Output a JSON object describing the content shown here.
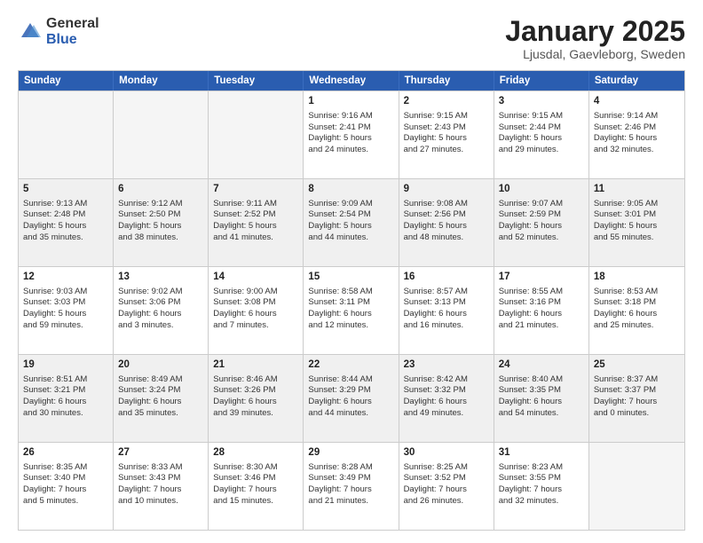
{
  "logo": {
    "general": "General",
    "blue": "Blue"
  },
  "header": {
    "title": "January 2025",
    "subtitle": "Ljusdal, Gaevleborg, Sweden"
  },
  "weekdays": [
    "Sunday",
    "Monday",
    "Tuesday",
    "Wednesday",
    "Thursday",
    "Friday",
    "Saturday"
  ],
  "weeks": [
    [
      {
        "day": "",
        "info": ""
      },
      {
        "day": "",
        "info": ""
      },
      {
        "day": "",
        "info": ""
      },
      {
        "day": "1",
        "info": "Sunrise: 9:16 AM\nSunset: 2:41 PM\nDaylight: 5 hours\nand 24 minutes."
      },
      {
        "day": "2",
        "info": "Sunrise: 9:15 AM\nSunset: 2:43 PM\nDaylight: 5 hours\nand 27 minutes."
      },
      {
        "day": "3",
        "info": "Sunrise: 9:15 AM\nSunset: 2:44 PM\nDaylight: 5 hours\nand 29 minutes."
      },
      {
        "day": "4",
        "info": "Sunrise: 9:14 AM\nSunset: 2:46 PM\nDaylight: 5 hours\nand 32 minutes."
      }
    ],
    [
      {
        "day": "5",
        "info": "Sunrise: 9:13 AM\nSunset: 2:48 PM\nDaylight: 5 hours\nand 35 minutes."
      },
      {
        "day": "6",
        "info": "Sunrise: 9:12 AM\nSunset: 2:50 PM\nDaylight: 5 hours\nand 38 minutes."
      },
      {
        "day": "7",
        "info": "Sunrise: 9:11 AM\nSunset: 2:52 PM\nDaylight: 5 hours\nand 41 minutes."
      },
      {
        "day": "8",
        "info": "Sunrise: 9:09 AM\nSunset: 2:54 PM\nDaylight: 5 hours\nand 44 minutes."
      },
      {
        "day": "9",
        "info": "Sunrise: 9:08 AM\nSunset: 2:56 PM\nDaylight: 5 hours\nand 48 minutes."
      },
      {
        "day": "10",
        "info": "Sunrise: 9:07 AM\nSunset: 2:59 PM\nDaylight: 5 hours\nand 52 minutes."
      },
      {
        "day": "11",
        "info": "Sunrise: 9:05 AM\nSunset: 3:01 PM\nDaylight: 5 hours\nand 55 minutes."
      }
    ],
    [
      {
        "day": "12",
        "info": "Sunrise: 9:03 AM\nSunset: 3:03 PM\nDaylight: 5 hours\nand 59 minutes."
      },
      {
        "day": "13",
        "info": "Sunrise: 9:02 AM\nSunset: 3:06 PM\nDaylight: 6 hours\nand 3 minutes."
      },
      {
        "day": "14",
        "info": "Sunrise: 9:00 AM\nSunset: 3:08 PM\nDaylight: 6 hours\nand 7 minutes."
      },
      {
        "day": "15",
        "info": "Sunrise: 8:58 AM\nSunset: 3:11 PM\nDaylight: 6 hours\nand 12 minutes."
      },
      {
        "day": "16",
        "info": "Sunrise: 8:57 AM\nSunset: 3:13 PM\nDaylight: 6 hours\nand 16 minutes."
      },
      {
        "day": "17",
        "info": "Sunrise: 8:55 AM\nSunset: 3:16 PM\nDaylight: 6 hours\nand 21 minutes."
      },
      {
        "day": "18",
        "info": "Sunrise: 8:53 AM\nSunset: 3:18 PM\nDaylight: 6 hours\nand 25 minutes."
      }
    ],
    [
      {
        "day": "19",
        "info": "Sunrise: 8:51 AM\nSunset: 3:21 PM\nDaylight: 6 hours\nand 30 minutes."
      },
      {
        "day": "20",
        "info": "Sunrise: 8:49 AM\nSunset: 3:24 PM\nDaylight: 6 hours\nand 35 minutes."
      },
      {
        "day": "21",
        "info": "Sunrise: 8:46 AM\nSunset: 3:26 PM\nDaylight: 6 hours\nand 39 minutes."
      },
      {
        "day": "22",
        "info": "Sunrise: 8:44 AM\nSunset: 3:29 PM\nDaylight: 6 hours\nand 44 minutes."
      },
      {
        "day": "23",
        "info": "Sunrise: 8:42 AM\nSunset: 3:32 PM\nDaylight: 6 hours\nand 49 minutes."
      },
      {
        "day": "24",
        "info": "Sunrise: 8:40 AM\nSunset: 3:35 PM\nDaylight: 6 hours\nand 54 minutes."
      },
      {
        "day": "25",
        "info": "Sunrise: 8:37 AM\nSunset: 3:37 PM\nDaylight: 7 hours\nand 0 minutes."
      }
    ],
    [
      {
        "day": "26",
        "info": "Sunrise: 8:35 AM\nSunset: 3:40 PM\nDaylight: 7 hours\nand 5 minutes."
      },
      {
        "day": "27",
        "info": "Sunrise: 8:33 AM\nSunset: 3:43 PM\nDaylight: 7 hours\nand 10 minutes."
      },
      {
        "day": "28",
        "info": "Sunrise: 8:30 AM\nSunset: 3:46 PM\nDaylight: 7 hours\nand 15 minutes."
      },
      {
        "day": "29",
        "info": "Sunrise: 8:28 AM\nSunset: 3:49 PM\nDaylight: 7 hours\nand 21 minutes."
      },
      {
        "day": "30",
        "info": "Sunrise: 8:25 AM\nSunset: 3:52 PM\nDaylight: 7 hours\nand 26 minutes."
      },
      {
        "day": "31",
        "info": "Sunrise: 8:23 AM\nSunset: 3:55 PM\nDaylight: 7 hours\nand 32 minutes."
      },
      {
        "day": "",
        "info": ""
      }
    ]
  ]
}
